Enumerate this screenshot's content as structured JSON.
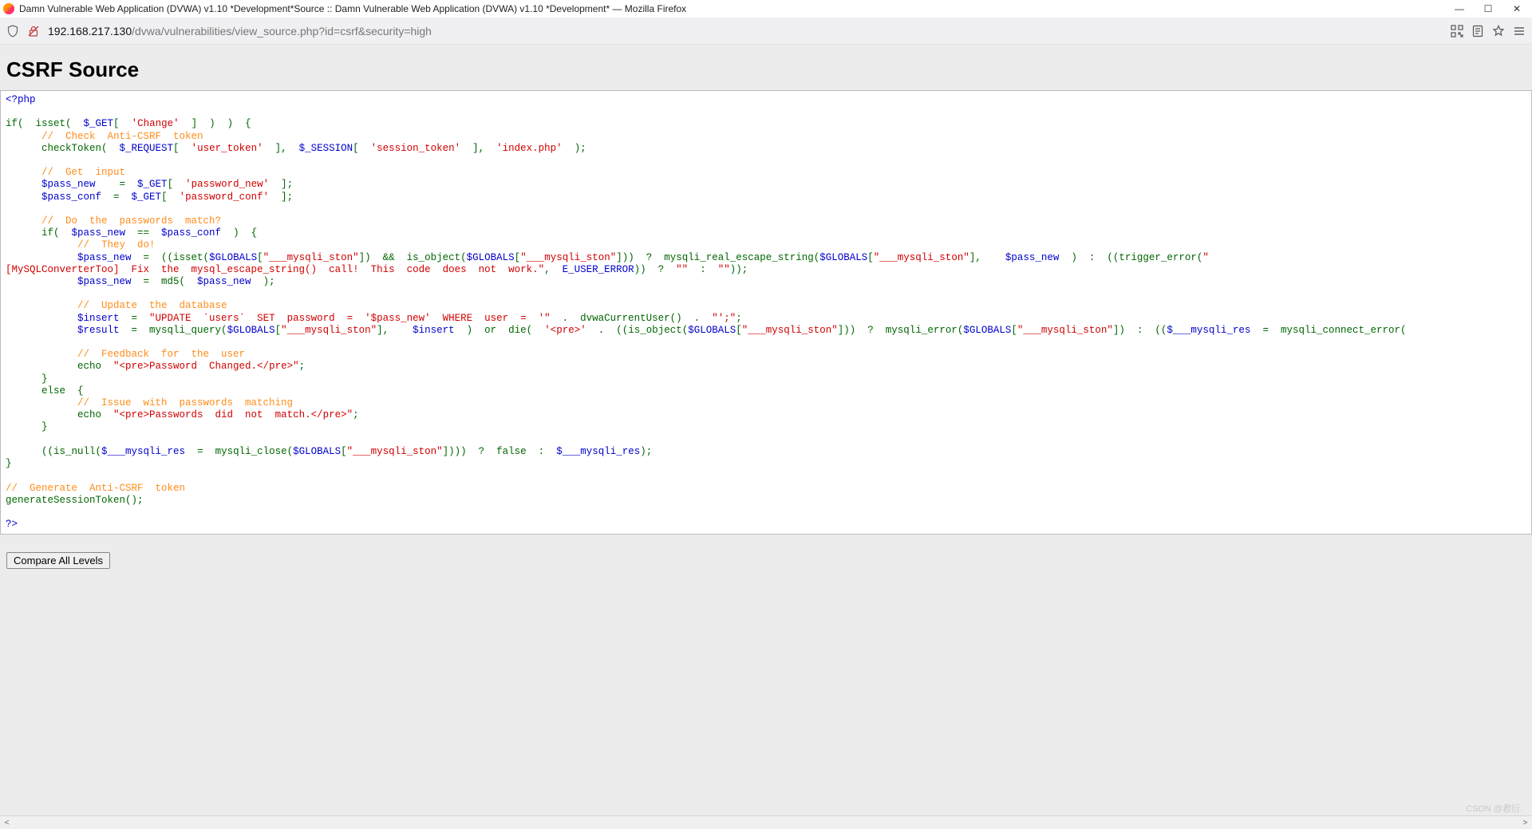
{
  "window": {
    "title": "Damn Vulnerable Web Application (DVWA) v1.10 *Development*Source :: Damn Vulnerable Web Application (DVWA) v1.10 *Development* — Mozilla Firefox",
    "min": "—",
    "max": "☐",
    "close": "✕"
  },
  "addressbar": {
    "host": "192.168.217.130",
    "path": "/dvwa/vulnerabilities/view_source.php?id=csrf&security=high"
  },
  "page": {
    "heading": "CSRF Source",
    "button": "Compare All Levels"
  },
  "code": {
    "l01": "<?php",
    "l02": "",
    "l03_a": "if(  isset(  ",
    "l03_b": "$_GET",
    "l03_c": "[  ",
    "l03_d": "'Change'",
    "l03_e": "  ]  )  )  {",
    "l04": "      //  Check  Anti-CSRF  token",
    "l05_a": "      checkToken(  ",
    "l05_b": "$_REQUEST",
    "l05_c": "[  ",
    "l05_d": "'user_token'",
    "l05_e": "  ],  ",
    "l05_f": "$_SESSION",
    "l05_g": "[  ",
    "l05_h": "'session_token'",
    "l05_i": "  ],  ",
    "l05_j": "'index.php'",
    "l05_k": "  );",
    "l06": "",
    "l07": "      //  Get  input",
    "l08_a": "      ",
    "l08_b": "$pass_new",
    "l08_c": "    =  ",
    "l08_d": "$_GET",
    "l08_e": "[  ",
    "l08_f": "'password_new'",
    "l08_g": "  ];",
    "l09_a": "      ",
    "l09_b": "$pass_conf",
    "l09_c": "  =  ",
    "l09_d": "$_GET",
    "l09_e": "[  ",
    "l09_f": "'password_conf'",
    "l09_g": "  ];",
    "l10": "",
    "l11": "      //  Do  the  passwords  match?",
    "l12_a": "      if(  ",
    "l12_b": "$pass_new",
    "l12_c": "  ==  ",
    "l12_d": "$pass_conf",
    "l12_e": "  )  {",
    "l13": "            //  They  do!",
    "l14_a": "            ",
    "l14_b": "$pass_new",
    "l14_c": "  =  ((isset(",
    "l14_d": "$GLOBALS",
    "l14_e": "[",
    "l14_f": "\"___mysqli_ston\"",
    "l14_g": "])  &&  is_object(",
    "l14_h": "$GLOBALS",
    "l14_i": "[",
    "l14_j": "\"___mysqli_ston\"",
    "l14_k": "]))  ?  mysqli_real_escape_string(",
    "l14_l": "$GLOBALS",
    "l14_m": "[",
    "l14_n": "\"___mysqli_ston\"",
    "l14_o": "],    ",
    "l14_p": "$pass_new",
    "l14_q": "  )  :  ((trigger_error(",
    "l14_r": "\"",
    "l15_a": "[MySQLConverterToo]  Fix  the  mysql_escape_string()  call!  This  code  does  not  work.\"",
    "l15_b": ",  ",
    "l15_c": "E_USER_ERROR",
    "l15_d": "))  ?  ",
    "l15_e": "\"\"",
    "l15_f": "  :  ",
    "l15_g": "\"\"",
    "l15_h": "));",
    "l16_a": "            ",
    "l16_b": "$pass_new",
    "l16_c": "  =  md5(  ",
    "l16_d": "$pass_new",
    "l16_e": "  );",
    "l17": "",
    "l18": "            //  Update  the  database",
    "l19_a": "            ",
    "l19_b": "$insert",
    "l19_c": "  =  ",
    "l19_d": "\"UPDATE  `users`  SET  password  =  '$pass_new'  WHERE  user  =  '\"",
    "l19_e": "  .  dvwaCurrentUser()  .  ",
    "l19_f": "\"';\"",
    "l19_g": ";",
    "l20_a": "            ",
    "l20_b": "$result",
    "l20_c": "  =  mysqli_query(",
    "l20_d": "$GLOBALS",
    "l20_e": "[",
    "l20_f": "\"___mysqli_ston\"",
    "l20_g": "],    ",
    "l20_h": "$insert",
    "l20_i": "  )  or  die(  ",
    "l20_j": "'<pre>'",
    "l20_k": "  .  ((is_object(",
    "l20_l": "$GLOBALS",
    "l20_m": "[",
    "l20_n": "\"___mysqli_ston\"",
    "l20_o": "]))  ?  mysqli_error(",
    "l20_p": "$GLOBALS",
    "l20_q": "[",
    "l20_r": "\"___mysqli_ston\"",
    "l20_s": "])  :  ((",
    "l20_t": "$___mysqli_res",
    "l20_u": "  =  mysqli_connect_error(",
    "l21": "",
    "l22": "            //  Feedback  for  the  user",
    "l23_a": "            echo  ",
    "l23_b": "\"<pre>Password  Changed.</pre>\"",
    "l23_c": ";",
    "l24": "      }",
    "l25_a": "      else  {",
    "l26": "            //  Issue  with  passwords  matching",
    "l27_a": "            echo  ",
    "l27_b": "\"<pre>Passwords  did  not  match.</pre>\"",
    "l27_c": ";",
    "l28": "      }",
    "l29": "",
    "l30_a": "      ((is_null(",
    "l30_b": "$___mysqli_res",
    "l30_c": "  =  mysqli_close(",
    "l30_d": "$GLOBALS",
    "l30_e": "[",
    "l30_f": "\"___mysqli_ston\"",
    "l30_g": "])))  ?  false  :  ",
    "l30_h": "$___mysqli_res",
    "l30_i": ");",
    "l31": "}",
    "l32": "",
    "l33": "//  Generate  Anti-CSRF  token",
    "l34": "generateSessionToken();",
    "l35": "",
    "l36": "?>"
  },
  "watermark": "CSDN @君衍.⠀"
}
